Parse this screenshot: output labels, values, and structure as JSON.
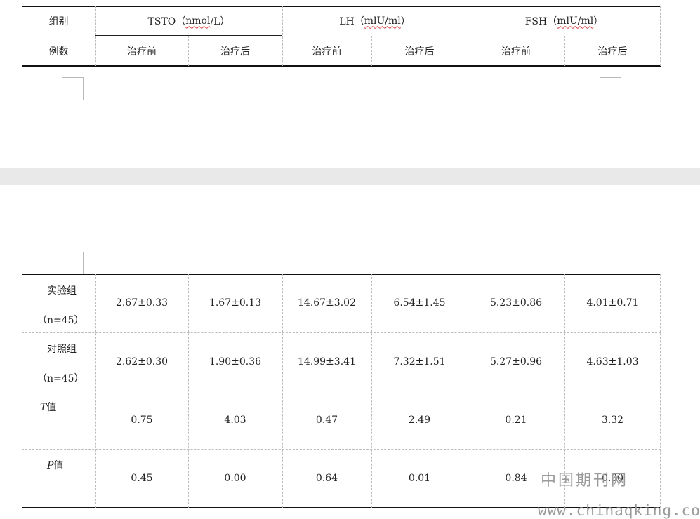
{
  "header": {
    "group_line1": "组别",
    "group_line2": "例数",
    "tsto": "TSTO（nmol/L）",
    "tsto_prefix": "TSTO（",
    "tsto_unit": "nmol",
    "tsto_suffix": "/L）",
    "lh_prefix": "LH（",
    "lh_unit": "mlU/ml",
    "lh_suffix": "）",
    "fsh_prefix": "FSH（",
    "fsh_unit": "mlU/ml",
    "fsh_suffix": "）",
    "sub": [
      "治疗前",
      "治疗后",
      "治疗前",
      "治疗后",
      "治疗前",
      "治疗后"
    ]
  },
  "rows": [
    {
      "name": "实验组",
      "count": "（n=45）",
      "values": [
        "2.67±0.33",
        "1.67±0.13",
        "14.67±3.02",
        "6.54±1.45",
        "5.23±0.86",
        "4.01±0.71"
      ]
    },
    {
      "name": "对照组",
      "count": "（n=45）",
      "values": [
        "2.62±0.30",
        "1.90±0.36",
        "14.99±3.41",
        "7.32±1.51",
        "5.27±0.96",
        "4.63±1.03"
      ]
    },
    {
      "name_italic": "T",
      "name_rest": "值",
      "values": [
        "0.75",
        "4.03",
        "0.47",
        "2.49",
        "0.21",
        "3.32"
      ]
    },
    {
      "name_italic": "P",
      "name_rest": "值",
      "values": [
        "0.45",
        "0.00",
        "0.64",
        "0.01",
        "0.84",
        "0.00"
      ]
    }
  ],
  "watermark": {
    "line1": "中国期刊网",
    "line2": "www.chinaqking.com"
  }
}
